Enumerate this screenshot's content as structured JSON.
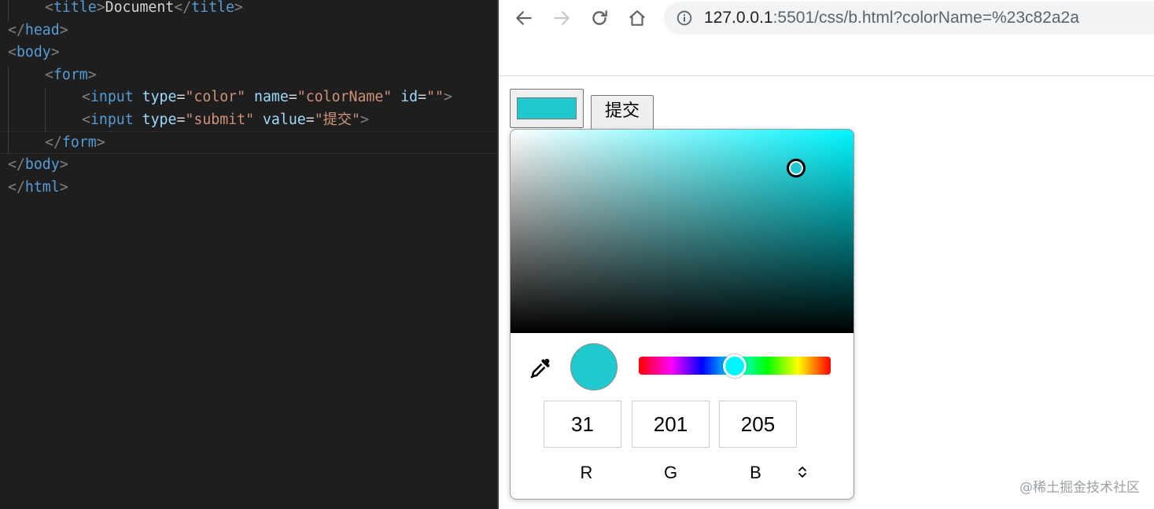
{
  "editor": {
    "lines": [
      {
        "indent": 1,
        "tokens": [
          [
            "b",
            "<"
          ],
          [
            "t",
            "title"
          ],
          [
            "b",
            ">"
          ],
          [
            "x",
            "Document"
          ],
          [
            "b",
            "</"
          ],
          [
            "t",
            "title"
          ],
          [
            "b",
            ">"
          ]
        ]
      },
      {
        "indent": 0,
        "tokens": [
          [
            "b",
            "</"
          ],
          [
            "t",
            "head"
          ],
          [
            "b",
            ">"
          ]
        ]
      },
      {
        "indent": 0,
        "tokens": [
          [
            "b",
            "<"
          ],
          [
            "t",
            "body"
          ],
          [
            "b",
            ">"
          ]
        ]
      },
      {
        "indent": 1,
        "tokens": [
          [
            "b",
            "<"
          ],
          [
            "t",
            "form"
          ],
          [
            "b",
            ">"
          ]
        ]
      },
      {
        "indent": 2,
        "tokens": [
          [
            "b",
            "<"
          ],
          [
            "t",
            "input"
          ],
          [
            "x",
            " "
          ],
          [
            "a",
            "type"
          ],
          [
            "x",
            "="
          ],
          [
            "s",
            "\"color\""
          ],
          [
            "x",
            " "
          ],
          [
            "a",
            "name"
          ],
          [
            "x",
            "="
          ],
          [
            "s",
            "\"colorName\""
          ],
          [
            "x",
            " "
          ],
          [
            "a",
            "id"
          ],
          [
            "x",
            "="
          ],
          [
            "s",
            "\"\""
          ],
          [
            "b",
            ">"
          ]
        ]
      },
      {
        "indent": 2,
        "tokens": [
          [
            "b",
            "<"
          ],
          [
            "t",
            "input"
          ],
          [
            "x",
            " "
          ],
          [
            "a",
            "type"
          ],
          [
            "x",
            "="
          ],
          [
            "s",
            "\"submit\""
          ],
          [
            "x",
            " "
          ],
          [
            "a",
            "value"
          ],
          [
            "x",
            "="
          ],
          [
            "s",
            "\"提交\""
          ],
          [
            "b",
            ">"
          ]
        ]
      },
      {
        "indent": 1,
        "tokens": [
          [
            "b",
            "</"
          ],
          [
            "t",
            "form"
          ],
          [
            "b",
            ">"
          ]
        ]
      },
      {
        "indent": 0,
        "tokens": [
          [
            "b",
            "</"
          ],
          [
            "t",
            "body"
          ],
          [
            "b",
            ">"
          ]
        ]
      },
      {
        "indent": 0,
        "tokens": [
          [
            "b",
            "</"
          ],
          [
            "t",
            "html"
          ],
          [
            "b",
            ">"
          ]
        ]
      }
    ]
  },
  "browser": {
    "nav": {
      "back_icon": "arrow-left-icon",
      "forward_icon": "arrow-right-icon",
      "reload_icon": "reload-icon",
      "home_icon": "home-icon"
    },
    "address": {
      "host": "127.0.0.1",
      "rest": ":5501/css/b.html?colorName=%23c82a2a",
      "info_icon": "info-icon"
    },
    "page": {
      "color_input_value": "#1fc9cd",
      "submit_label": "提交"
    },
    "picker": {
      "hue_color": "#00f6ff",
      "current_color": "#1fc9cd",
      "hue_fraction": 0.5,
      "eyedropper_icon": "eyedropper-icon",
      "toggle_icon": "format-toggle-icon",
      "channels": [
        {
          "label": "R",
          "value": "31"
        },
        {
          "label": "G",
          "value": "201"
        },
        {
          "label": "B",
          "value": "205"
        }
      ]
    }
  },
  "watermark": "@稀土掘金技术社区"
}
